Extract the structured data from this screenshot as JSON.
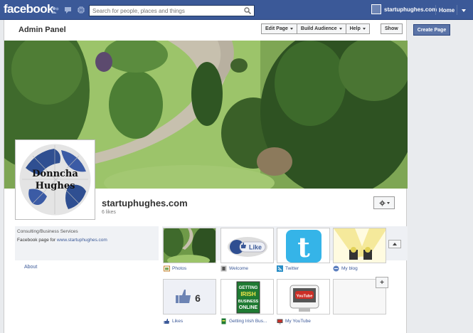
{
  "topbar": {
    "logo": "facebook",
    "search_placeholder": "Search for people, places and things",
    "user_name": "startuphughes.com",
    "home_label": "Home"
  },
  "admin": {
    "title": "Admin Panel",
    "edit_page": "Edit Page",
    "build_audience": "Build Audience",
    "help": "Help",
    "show": "Show"
  },
  "page": {
    "profile_text_line1": "Donncha",
    "profile_text_line2": "Hughes",
    "name": "startuphughes.com",
    "likes": "6 likes",
    "category": "Consulting/Business Services",
    "description_prefix": "Facebook page for ",
    "description_link": "www.startuphughes.com",
    "about": "About"
  },
  "apps": [
    {
      "label": "Photos",
      "icon": "photos-icon"
    },
    {
      "label": "Welcome",
      "icon": "welcome-icon",
      "thumb_text": "Like"
    },
    {
      "label": "Twitter",
      "icon": "twitter-icon"
    },
    {
      "label": "My blog",
      "icon": "blog-icon"
    },
    {
      "label": "Likes",
      "icon": "likes-icon",
      "thumb_text": "6"
    },
    {
      "label": "Getting Irish Bus...",
      "icon": "getting-irish-icon",
      "thumb_lines": [
        "GETTING",
        "IRISH",
        "BUSINESS",
        "ONLINE"
      ]
    },
    {
      "label": "My YouTube",
      "icon": "youtube-icon",
      "thumb_text": "YouTube"
    }
  ],
  "sidebar": {
    "create_page": "Create Page"
  },
  "colors": {
    "brand": "#3b5998",
    "background": "#e9ebee"
  }
}
